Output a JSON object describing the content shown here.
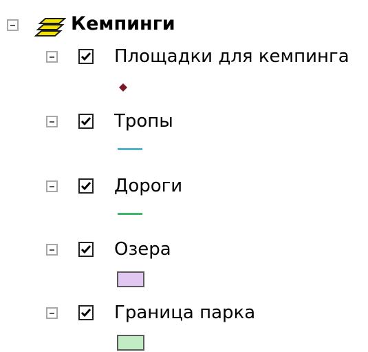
{
  "group": {
    "label": "Кемпинги",
    "icon": "layers-icon",
    "expanded": true
  },
  "layers": [
    {
      "label": "Площадки для кемпинга",
      "checked": true,
      "symbol": {
        "kind": "point",
        "icon": "diamond-marker-icon",
        "color": "#7a1a28"
      }
    },
    {
      "label": "Тропы",
      "checked": true,
      "symbol": {
        "kind": "line",
        "icon": "line-swatch-icon",
        "color": "#4fb3c9"
      }
    },
    {
      "label": "Дороги",
      "checked": true,
      "symbol": {
        "kind": "line",
        "icon": "line-swatch-icon",
        "color": "#3fb56a"
      }
    },
    {
      "label": "Озера",
      "checked": true,
      "symbol": {
        "kind": "polygon",
        "icon": "polygon-swatch-icon",
        "color": "#e0c8f2"
      }
    },
    {
      "label": "Граница парка",
      "checked": true,
      "symbol": {
        "kind": "polygon",
        "icon": "polygon-swatch-icon",
        "color": "#c2ecc4"
      }
    }
  ]
}
